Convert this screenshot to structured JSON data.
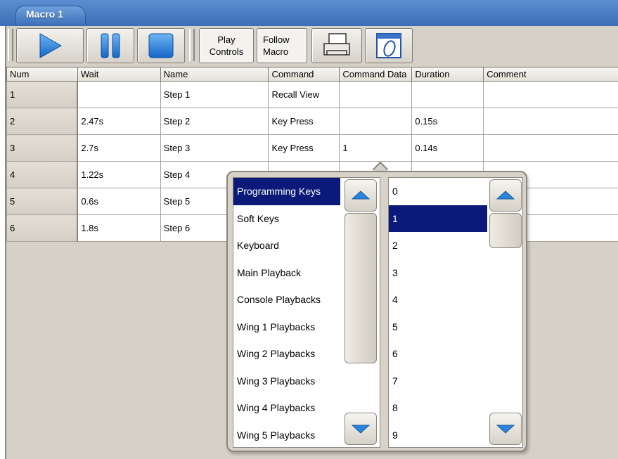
{
  "window": {
    "title": "Macro 1"
  },
  "toolbar": {
    "play_controls_line1": "Play",
    "play_controls_line2": "Controls",
    "follow_macro_line1": "Follow",
    "follow_macro_line2": "Macro",
    "icons": [
      "play-icon",
      "pause-icon",
      "stop-icon",
      "print-icon",
      "edit-icon"
    ],
    "accent": "#1e7ad9"
  },
  "table": {
    "columns": [
      "Num",
      "Wait",
      "Name",
      "Command",
      "Command Data",
      "Duration",
      "Comment"
    ],
    "rows": [
      {
        "num": "1",
        "wait": "",
        "name": "Step 1",
        "command": "Recall View",
        "data": "",
        "duration": "",
        "comment": ""
      },
      {
        "num": "2",
        "wait": "2.47s",
        "name": "Step 2",
        "command": "Key Press",
        "data": "",
        "duration": "0.15s",
        "comment": ""
      },
      {
        "num": "3",
        "wait": "2.7s",
        "name": "Step 3",
        "command": "Key Press",
        "data": "1",
        "duration": "0.14s",
        "comment": ""
      },
      {
        "num": "4",
        "wait": "1.22s",
        "name": "Step 4",
        "command": "",
        "data": "",
        "duration": "",
        "comment": ""
      },
      {
        "num": "5",
        "wait": "0.6s",
        "name": "Step 5",
        "command": "",
        "data": "",
        "duration": "",
        "comment": ""
      },
      {
        "num": "6",
        "wait": "1.8s",
        "name": "Step 6",
        "command": "",
        "data": "",
        "duration": "",
        "comment": ""
      }
    ]
  },
  "popup": {
    "categories": [
      "Programming Keys",
      "Soft Keys",
      "Keyboard",
      "Main Playback",
      "Console Playbacks",
      "Wing 1 Playbacks",
      "Wing 2 Playbacks",
      "Wing 3 Playbacks",
      "Wing 4 Playbacks",
      "Wing 5 Playbacks"
    ],
    "selected_category": "Programming Keys",
    "keys": [
      "0",
      "1",
      "2",
      "3",
      "4",
      "5",
      "6",
      "7",
      "8",
      "9"
    ],
    "selected_key": "1",
    "selection_color": "#0b1a78"
  }
}
